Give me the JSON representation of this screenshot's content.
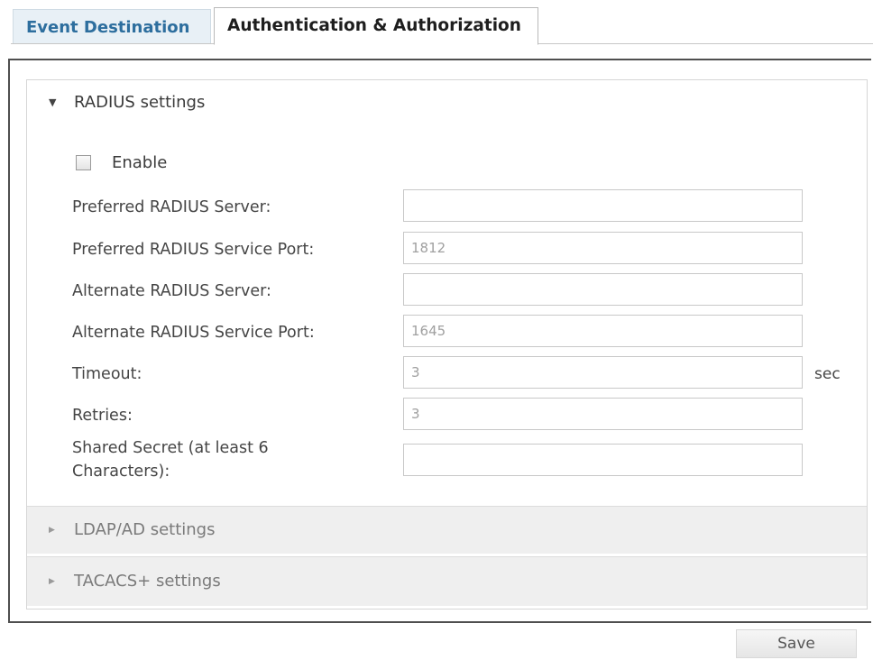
{
  "tabs": [
    {
      "label": "Event Destination",
      "active": false
    },
    {
      "label": "Authentication & Authorization",
      "active": true
    }
  ],
  "sections": {
    "radius": {
      "title": "RADIUS settings",
      "expanded": true,
      "arrow_icon": "triangle-down-icon",
      "enable_label": "Enable",
      "enable_checked": false,
      "fields": {
        "preferred_server": {
          "label": "Preferred RADIUS Server:",
          "value": ""
        },
        "preferred_port": {
          "label": "Preferred RADIUS Service Port:",
          "value": "1812"
        },
        "alternate_server": {
          "label": "Alternate RADIUS Server:",
          "value": ""
        },
        "alternate_port": {
          "label": "Alternate RADIUS Service Port:",
          "value": "1645"
        },
        "timeout": {
          "label": "Timeout:",
          "value": "3",
          "unit": "sec"
        },
        "retries": {
          "label": "Retries:",
          "value": "3"
        },
        "shared_secret": {
          "label": "Shared Secret (at least 6 Characters):",
          "value": ""
        }
      }
    },
    "ldap": {
      "title": "LDAP/AD settings",
      "expanded": false,
      "arrow_icon": "triangle-right-icon"
    },
    "tacacs": {
      "title": "TACACS+ settings",
      "expanded": false,
      "arrow_icon": "triangle-right-icon"
    }
  },
  "actions": {
    "save_label": "Save"
  },
  "colors": {
    "inactive_tab_text": "#2d6e9e",
    "inactive_tab_bg": "#e8f0f6",
    "collapsed_section_bg": "#efefef",
    "panel_border": "#4f4f4f"
  }
}
